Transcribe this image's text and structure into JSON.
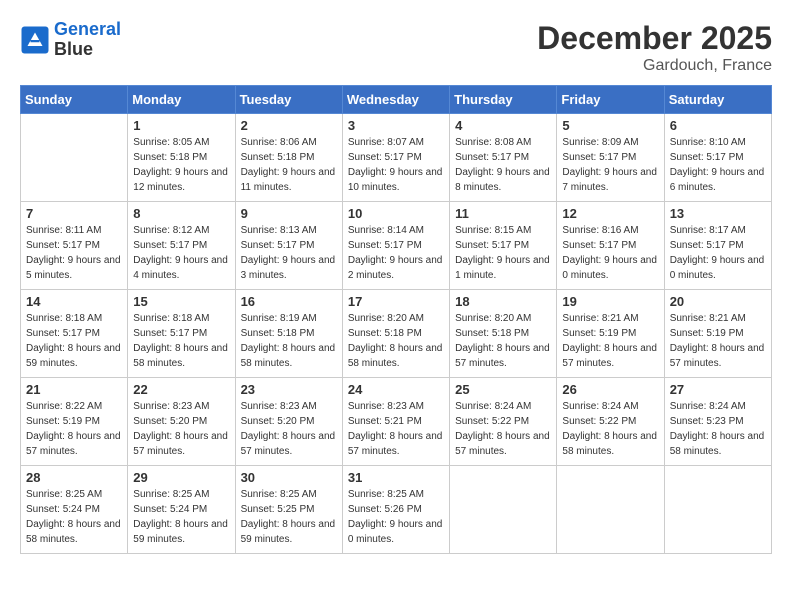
{
  "header": {
    "logo_line1": "General",
    "logo_line2": "Blue",
    "month": "December 2025",
    "location": "Gardouch, France"
  },
  "weekdays": [
    "Sunday",
    "Monday",
    "Tuesday",
    "Wednesday",
    "Thursday",
    "Friday",
    "Saturday"
  ],
  "weeks": [
    [
      {
        "day": "",
        "sunrise": "",
        "sunset": "",
        "daylight": ""
      },
      {
        "day": "1",
        "sunrise": "Sunrise: 8:05 AM",
        "sunset": "Sunset: 5:18 PM",
        "daylight": "Daylight: 9 hours and 12 minutes."
      },
      {
        "day": "2",
        "sunrise": "Sunrise: 8:06 AM",
        "sunset": "Sunset: 5:18 PM",
        "daylight": "Daylight: 9 hours and 11 minutes."
      },
      {
        "day": "3",
        "sunrise": "Sunrise: 8:07 AM",
        "sunset": "Sunset: 5:17 PM",
        "daylight": "Daylight: 9 hours and 10 minutes."
      },
      {
        "day": "4",
        "sunrise": "Sunrise: 8:08 AM",
        "sunset": "Sunset: 5:17 PM",
        "daylight": "Daylight: 9 hours and 8 minutes."
      },
      {
        "day": "5",
        "sunrise": "Sunrise: 8:09 AM",
        "sunset": "Sunset: 5:17 PM",
        "daylight": "Daylight: 9 hours and 7 minutes."
      },
      {
        "day": "6",
        "sunrise": "Sunrise: 8:10 AM",
        "sunset": "Sunset: 5:17 PM",
        "daylight": "Daylight: 9 hours and 6 minutes."
      }
    ],
    [
      {
        "day": "7",
        "sunrise": "Sunrise: 8:11 AM",
        "sunset": "Sunset: 5:17 PM",
        "daylight": "Daylight: 9 hours and 5 minutes."
      },
      {
        "day": "8",
        "sunrise": "Sunrise: 8:12 AM",
        "sunset": "Sunset: 5:17 PM",
        "daylight": "Daylight: 9 hours and 4 minutes."
      },
      {
        "day": "9",
        "sunrise": "Sunrise: 8:13 AM",
        "sunset": "Sunset: 5:17 PM",
        "daylight": "Daylight: 9 hours and 3 minutes."
      },
      {
        "day": "10",
        "sunrise": "Sunrise: 8:14 AM",
        "sunset": "Sunset: 5:17 PM",
        "daylight": "Daylight: 9 hours and 2 minutes."
      },
      {
        "day": "11",
        "sunrise": "Sunrise: 8:15 AM",
        "sunset": "Sunset: 5:17 PM",
        "daylight": "Daylight: 9 hours and 1 minute."
      },
      {
        "day": "12",
        "sunrise": "Sunrise: 8:16 AM",
        "sunset": "Sunset: 5:17 PM",
        "daylight": "Daylight: 9 hours and 0 minutes."
      },
      {
        "day": "13",
        "sunrise": "Sunrise: 8:17 AM",
        "sunset": "Sunset: 5:17 PM",
        "daylight": "Daylight: 9 hours and 0 minutes."
      }
    ],
    [
      {
        "day": "14",
        "sunrise": "Sunrise: 8:18 AM",
        "sunset": "Sunset: 5:17 PM",
        "daylight": "Daylight: 8 hours and 59 minutes."
      },
      {
        "day": "15",
        "sunrise": "Sunrise: 8:18 AM",
        "sunset": "Sunset: 5:17 PM",
        "daylight": "Daylight: 8 hours and 58 minutes."
      },
      {
        "day": "16",
        "sunrise": "Sunrise: 8:19 AM",
        "sunset": "Sunset: 5:18 PM",
        "daylight": "Daylight: 8 hours and 58 minutes."
      },
      {
        "day": "17",
        "sunrise": "Sunrise: 8:20 AM",
        "sunset": "Sunset: 5:18 PM",
        "daylight": "Daylight: 8 hours and 58 minutes."
      },
      {
        "day": "18",
        "sunrise": "Sunrise: 8:20 AM",
        "sunset": "Sunset: 5:18 PM",
        "daylight": "Daylight: 8 hours and 57 minutes."
      },
      {
        "day": "19",
        "sunrise": "Sunrise: 8:21 AM",
        "sunset": "Sunset: 5:19 PM",
        "daylight": "Daylight: 8 hours and 57 minutes."
      },
      {
        "day": "20",
        "sunrise": "Sunrise: 8:21 AM",
        "sunset": "Sunset: 5:19 PM",
        "daylight": "Daylight: 8 hours and 57 minutes."
      }
    ],
    [
      {
        "day": "21",
        "sunrise": "Sunrise: 8:22 AM",
        "sunset": "Sunset: 5:19 PM",
        "daylight": "Daylight: 8 hours and 57 minutes."
      },
      {
        "day": "22",
        "sunrise": "Sunrise: 8:23 AM",
        "sunset": "Sunset: 5:20 PM",
        "daylight": "Daylight: 8 hours and 57 minutes."
      },
      {
        "day": "23",
        "sunrise": "Sunrise: 8:23 AM",
        "sunset": "Sunset: 5:20 PM",
        "daylight": "Daylight: 8 hours and 57 minutes."
      },
      {
        "day": "24",
        "sunrise": "Sunrise: 8:23 AM",
        "sunset": "Sunset: 5:21 PM",
        "daylight": "Daylight: 8 hours and 57 minutes."
      },
      {
        "day": "25",
        "sunrise": "Sunrise: 8:24 AM",
        "sunset": "Sunset: 5:22 PM",
        "daylight": "Daylight: 8 hours and 57 minutes."
      },
      {
        "day": "26",
        "sunrise": "Sunrise: 8:24 AM",
        "sunset": "Sunset: 5:22 PM",
        "daylight": "Daylight: 8 hours and 58 minutes."
      },
      {
        "day": "27",
        "sunrise": "Sunrise: 8:24 AM",
        "sunset": "Sunset: 5:23 PM",
        "daylight": "Daylight: 8 hours and 58 minutes."
      }
    ],
    [
      {
        "day": "28",
        "sunrise": "Sunrise: 8:25 AM",
        "sunset": "Sunset: 5:24 PM",
        "daylight": "Daylight: 8 hours and 58 minutes."
      },
      {
        "day": "29",
        "sunrise": "Sunrise: 8:25 AM",
        "sunset": "Sunset: 5:24 PM",
        "daylight": "Daylight: 8 hours and 59 minutes."
      },
      {
        "day": "30",
        "sunrise": "Sunrise: 8:25 AM",
        "sunset": "Sunset: 5:25 PM",
        "daylight": "Daylight: 8 hours and 59 minutes."
      },
      {
        "day": "31",
        "sunrise": "Sunrise: 8:25 AM",
        "sunset": "Sunset: 5:26 PM",
        "daylight": "Daylight: 9 hours and 0 minutes."
      },
      {
        "day": "",
        "sunrise": "",
        "sunset": "",
        "daylight": ""
      },
      {
        "day": "",
        "sunrise": "",
        "sunset": "",
        "daylight": ""
      },
      {
        "day": "",
        "sunrise": "",
        "sunset": "",
        "daylight": ""
      }
    ]
  ]
}
